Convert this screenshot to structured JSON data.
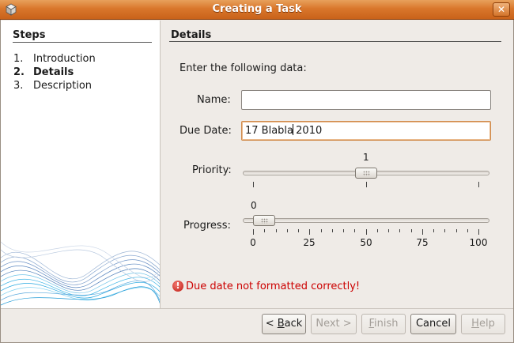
{
  "window": {
    "title": "Creating a Task",
    "close_glyph": "✕"
  },
  "steps": {
    "title": "Steps",
    "items": [
      {
        "num": "1.",
        "label": "Introduction"
      },
      {
        "num": "2.",
        "label": "Details"
      },
      {
        "num": "3.",
        "label": "Description"
      }
    ],
    "current_index": 1
  },
  "details": {
    "title": "Details",
    "instruction": "Enter the following data:",
    "name_label": "Name:",
    "name_value": "",
    "due_date_label": "Due Date:",
    "due_date_value_before_caret": "17 Blabla",
    "due_date_value_after_caret": " 2010",
    "priority_label": "Priority:",
    "priority_value": "1",
    "priority_level": 1,
    "priority_max": 2,
    "progress_label": "Progress:",
    "progress_value": "0",
    "progress_level": 0,
    "progress_max": 100,
    "progress_tick_labels": [
      "0",
      "25",
      "50",
      "75",
      "100"
    ]
  },
  "error": {
    "icon": "error-icon",
    "glyph": "!",
    "message": "Due date not formatted correctly!",
    "color": "#cc0000"
  },
  "buttons": {
    "back": {
      "label_pre": "< ",
      "mnemonic": "B",
      "label_post": "ack",
      "enabled": true
    },
    "next": {
      "label": "Next >",
      "enabled": false
    },
    "finish": {
      "label_pre": "",
      "mnemonic": "F",
      "label_post": "inish",
      "enabled": false
    },
    "cancel": {
      "label": "Cancel",
      "enabled": true
    },
    "help": {
      "label_pre": "",
      "mnemonic": "H",
      "label_post": "elp",
      "enabled": false
    }
  },
  "colors": {
    "titlebar": "#d9772c",
    "focus_border": "#d08a4a"
  }
}
